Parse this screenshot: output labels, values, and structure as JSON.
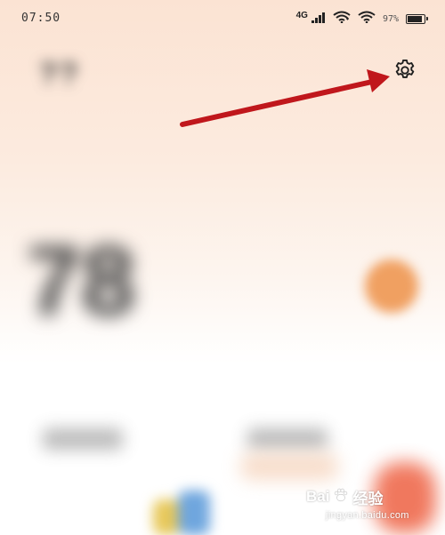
{
  "status_bar": {
    "time": "07:50",
    "signal_tech": "4G",
    "battery_text": "97%",
    "battery_level": 0.97
  },
  "header": {
    "title": "??"
  },
  "settings": {
    "icon": "gear-icon"
  },
  "annotation": {
    "arrow_color": "#c0171c",
    "points_to": "settings-button"
  },
  "main": {
    "score": "78"
  },
  "watermark": {
    "brand_prefix": "Bai",
    "brand_suffix": "经验",
    "url": "jingyan.baidu.com"
  },
  "colors": {
    "accent_orange": "#f0a061",
    "background_top": "#fbe3d3",
    "background_bottom": "#ffffff"
  }
}
